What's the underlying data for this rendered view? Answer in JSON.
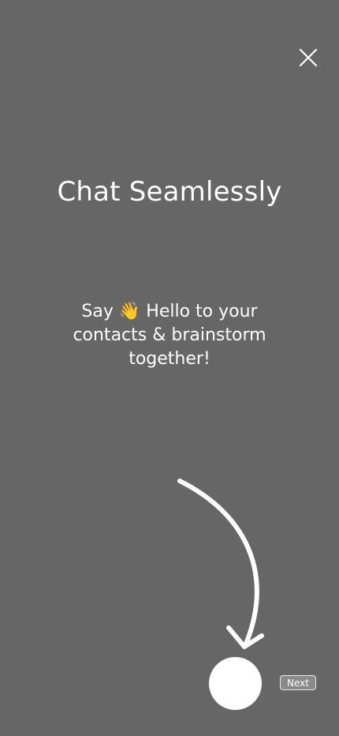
{
  "onboarding": {
    "title": "Chat Seamlessly",
    "subtitle_prefix": "Say ",
    "subtitle_emoji": "👋",
    "subtitle_suffix": " Hello to your contacts & brainstorm together!",
    "next_label": "Next"
  },
  "icons": {
    "close": "close-icon",
    "arrow": "curved-arrow-down-icon"
  },
  "colors": {
    "background": "#666666",
    "foreground": "#ffffff"
  }
}
